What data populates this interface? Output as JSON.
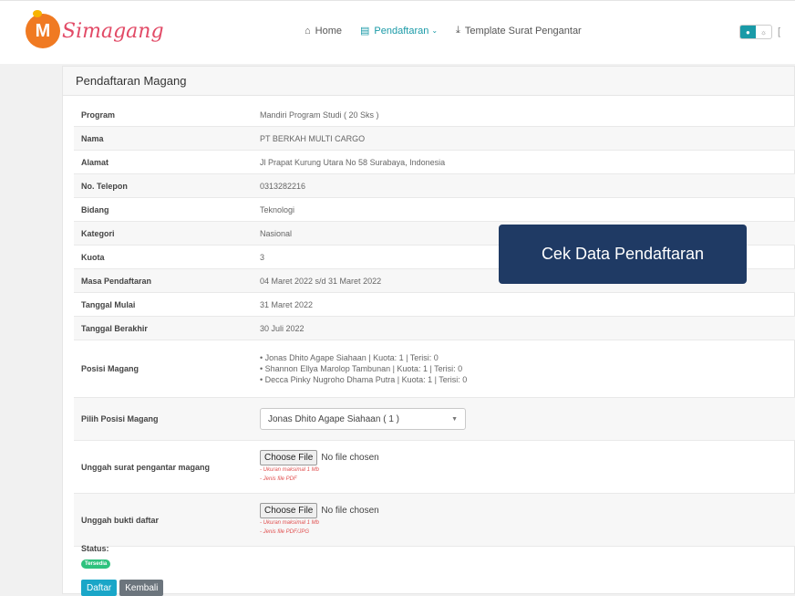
{
  "brand": {
    "logo_letter": "M",
    "name": "Simagang"
  },
  "nav": {
    "home": "Home",
    "pendaftaran": "Pendaftaran",
    "template": "Template Surat Pengantar"
  },
  "card": {
    "title": "Pendaftaran Magang",
    "rows": [
      {
        "label": "Program",
        "value": "Mandiri Program Studi ( 20 Sks )"
      },
      {
        "label": "Nama",
        "value": "PT BERKAH MULTI CARGO"
      },
      {
        "label": "Alamat",
        "value": "Jl Prapat Kurung Utara No 58 Surabaya, Indonesia"
      },
      {
        "label": "No. Telepon",
        "value": "0313282216"
      },
      {
        "label": "Bidang",
        "value": "Teknologi"
      },
      {
        "label": "Kategori",
        "value": "Nasional"
      },
      {
        "label": "Kuota",
        "value": "3"
      },
      {
        "label": "Masa Pendaftaran",
        "value": "04 Maret 2022 s/d 31 Maret 2022"
      },
      {
        "label": "Tanggal Mulai",
        "value": "31 Maret 2022"
      },
      {
        "label": "Tanggal Berakhir",
        "value": "30 Juli 2022"
      }
    ],
    "posisi_label": "Posisi Magang",
    "posisi_items": [
      "Jonas Dhito Agape Siahaan | Kuota: 1 | Terisi: 0",
      "Shannon Ellya Marolop Tambunan | Kuota: 1 | Terisi: 0",
      "Decca Pinky Nugroho Dhama Putra | Kuota: 1 | Terisi: 0"
    ],
    "pilih_label": "Pilih Posisi Magang",
    "pilih_value": "Jonas Dhito Agape Siahaan ( 1 )",
    "surat_label": "Unggah surat pengantar magang",
    "surat_hints": [
      "- Ukuran maksimal 1 Mb",
      "- Jenis file PDF"
    ],
    "bukti_label": "Unggah bukti daftar",
    "bukti_hints": [
      "- Ukuran maksimal 1 Mb",
      "- Jenis file PDF/JPG"
    ],
    "file_button": "Choose File",
    "file_status": "No file chosen",
    "status_label": "Status:",
    "status_badge": "Tersedia",
    "btn_daftar": "Daftar",
    "btn_kembali": "Kembali"
  },
  "callout": {
    "text": "Cek Data Pendaftaran"
  },
  "colors": {
    "accent": "#1a9aa7",
    "callout_bg": "#1f3a64",
    "badge": "#2ec27e"
  }
}
